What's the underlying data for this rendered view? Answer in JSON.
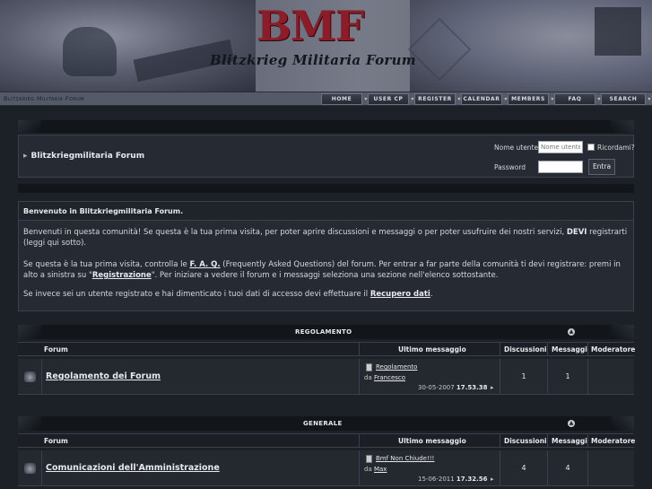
{
  "header": {
    "logo_title": "BMF",
    "logo_subtitle": "Blitzkrieg Militaria Forum"
  },
  "navbar": {
    "site_name": "Blitzkrieg Militaria Forum",
    "buttons": [
      "HOME",
      "USER CP",
      "REGISTER",
      "CALENDAR",
      "MEMBERS",
      "FAQ",
      "SEARCH"
    ]
  },
  "login": {
    "forum_title": "Blitzkriegmilitaria Forum",
    "username_label": "Nome utente",
    "username_placeholder": "Nome utente",
    "password_label": "Password",
    "remember_label": "Ricordami?",
    "submit_label": "Entra"
  },
  "welcome": {
    "heading": "Benvenuto in Blitzkriegmilitaria Forum.",
    "p1_a": "Benvenuti in questa comunità! Se questa è la tua prima visita, per poter aprire discussioni e messaggi o per poter usufruire dei nostri servizi, ",
    "p1_b": "DEVI",
    "p1_c": " registrarti (leggi qui sotto).",
    "p2_a": "Se questa è la tua prima visita, controlla le ",
    "p2_link": "F. A. Q.",
    "p2_b": " (Frequently Asked Questions) del forum. Per entrar a far parte della comunità ti devi registrare: premi in alto a sinistra su \"",
    "p2_reg": "Registrazione",
    "p2_c": "\". Per iniziare a vedere il forum e i messaggi seleziona una sezione nell'elenco sottostante.",
    "p3_a": "Se invece sei un utente registrato e hai dimenticato i tuoi dati di accesso devi effettuare il ",
    "p3_link": "Recupero dati",
    "p3_b": "."
  },
  "columns": {
    "forum": "Forum",
    "last_post": "Ultimo messaggio",
    "threads": "Discussioni",
    "posts": "Messaggi",
    "moderator": "Moderatore"
  },
  "categories": [
    {
      "title": "REGOLAMENTO",
      "forum_name": "Regolamento dei Forum",
      "last_title": "Regolamento",
      "by_label": "da",
      "last_user": "Francesco",
      "last_date": "30-05-2007",
      "last_time": "17.53.38",
      "threads": "1",
      "posts": "1"
    },
    {
      "title": "GENERALE",
      "forum_name": "Comunicazioni dell'Amministrazione",
      "last_title": "Bmf Non Chiude!!!",
      "by_label": "da",
      "last_user": "Max",
      "last_date": "15-06-2011",
      "last_time": "17.32.56",
      "threads": "4",
      "posts": "4"
    }
  ]
}
